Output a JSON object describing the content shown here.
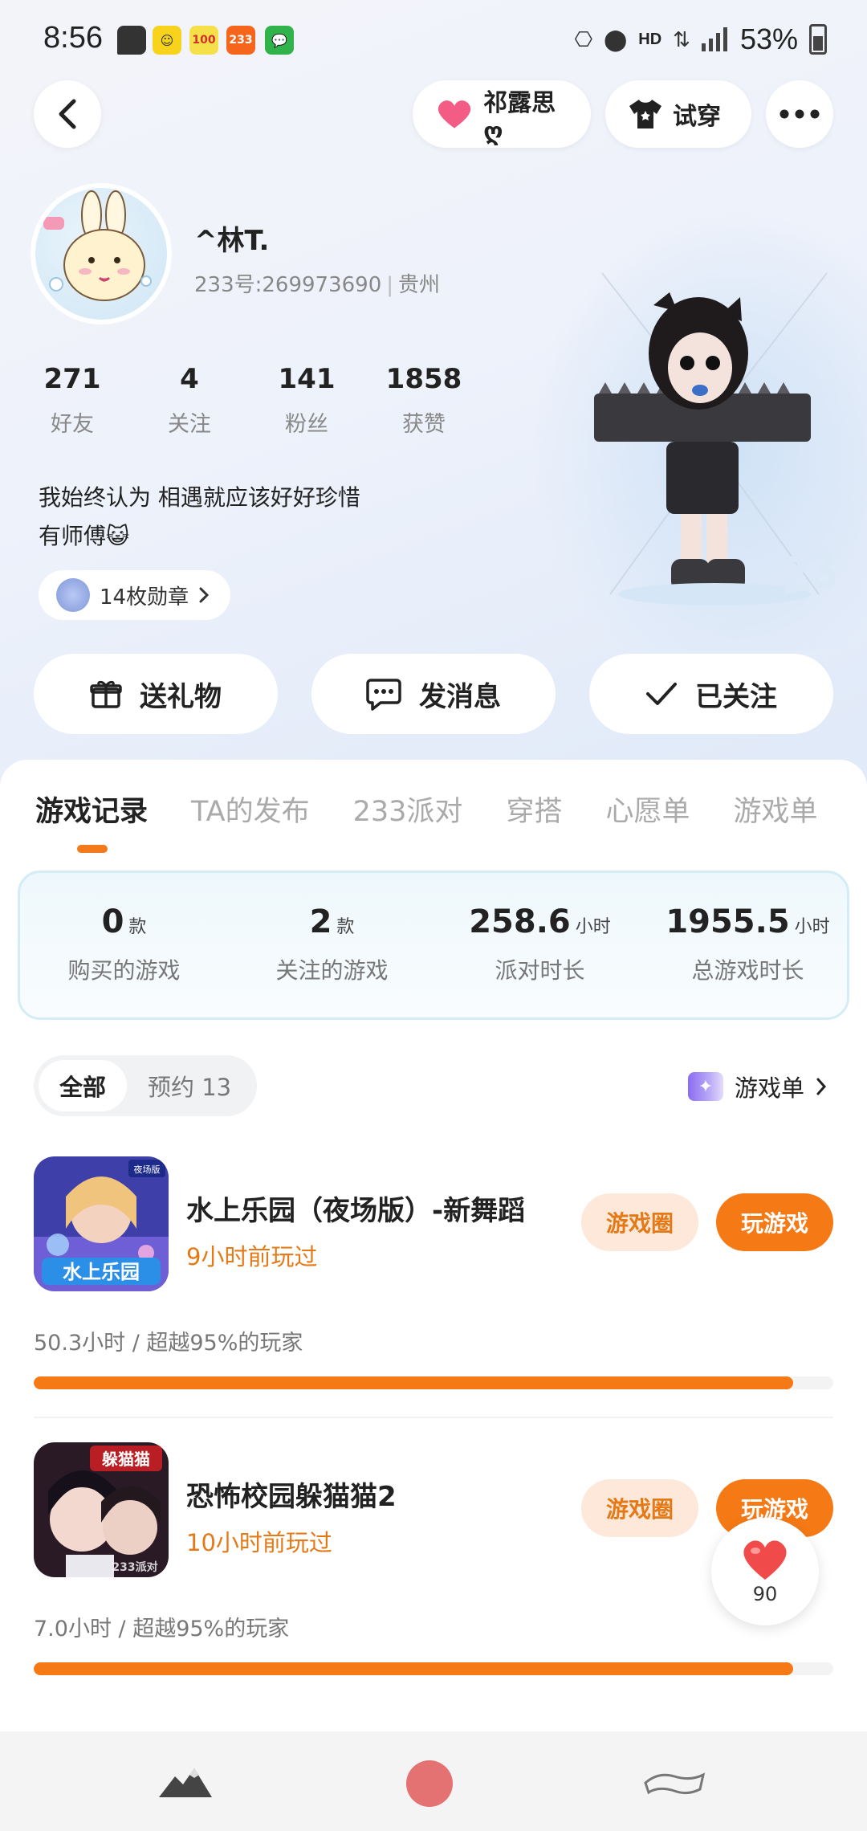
{
  "status_bar": {
    "time": "8:56",
    "notifications": [
      "message-icon",
      "app-icon-yellow",
      "app-icon-100",
      "app-icon-233",
      "wechat-icon"
    ],
    "notif_labels": {
      "n100": "100",
      "n233": "233"
    },
    "network": "HD",
    "battery": "53%"
  },
  "top_nav": {
    "partner_label": "祁露思ღ",
    "tryon_label": "试穿"
  },
  "profile": {
    "name": "^林T.",
    "id_text": "233号:269973690",
    "location": "贵州",
    "stats": [
      {
        "num": "271",
        "label": "好友"
      },
      {
        "num": "4",
        "label": "关注"
      },
      {
        "num": "141",
        "label": "粉丝"
      },
      {
        "num": "1858",
        "label": "获赞"
      }
    ],
    "bio_line1": "我始终认为 相遇就应该好好珍惜",
    "bio_line2": "有师傅😺",
    "badges_label": "14枚勋章"
  },
  "actions": {
    "gift": "送礼物",
    "message": "发消息",
    "following": "已关注"
  },
  "tabs": [
    "游戏记录",
    "TA的发布",
    "233派对",
    "穿搭",
    "心愿单",
    "游戏单"
  ],
  "summary": [
    {
      "value": "0",
      "unit": "款",
      "desc": "购买的游戏"
    },
    {
      "value": "2",
      "unit": "款",
      "desc": "关注的游戏"
    },
    {
      "value": "258.6",
      "unit": "小时",
      "desc": "派对时长"
    },
    {
      "value": "1955.5",
      "unit": "小时",
      "desc": "总游戏时长"
    }
  ],
  "filter": {
    "all": "全部",
    "reserved": "预约 13",
    "gamelist": "游戏单"
  },
  "games": [
    {
      "title": "水上乐园（夜场版）-新舞蹈",
      "played": "9小时前玩过",
      "circle_btn": "游戏圈",
      "play_btn": "玩游戏",
      "stat": "50.3小时 / 超越95%的玩家",
      "progress": 0.95,
      "icon_text": "水上乐园",
      "icon_tag": "夜场版"
    },
    {
      "title": "恐怖校园躲猫猫2",
      "played": "10小时前玩过",
      "circle_btn": "游戏圈",
      "play_btn": "玩游戏",
      "stat": "7.0小时 / 超越95%的玩家",
      "progress": 0.95,
      "icon_text": "躲猫猫",
      "icon_tag": "233派对"
    }
  ],
  "float_like": {
    "count": "90"
  },
  "colors": {
    "accent": "#f57a16",
    "accent_light": "#fde8d9",
    "played": "#e47a17"
  }
}
